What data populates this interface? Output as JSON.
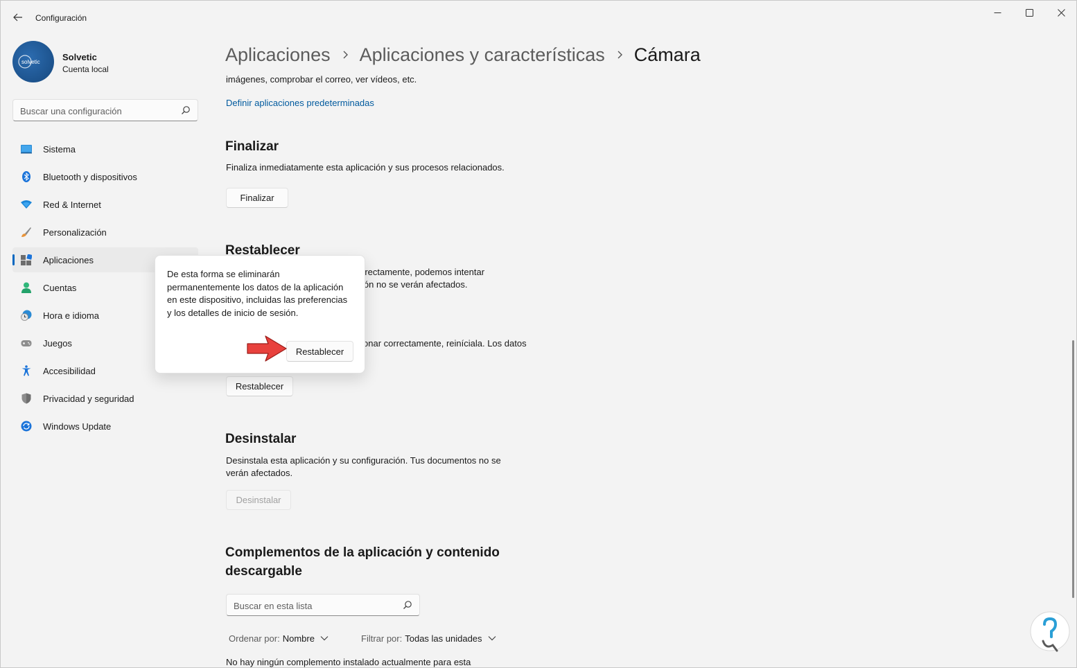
{
  "window": {
    "title": "Configuración",
    "controls": {
      "minimize": "minimize-icon",
      "maximize": "maximize-icon",
      "close": "close-icon"
    }
  },
  "profile": {
    "avatar_text": "solvetic",
    "name": "Solvetic",
    "account": "Cuenta local"
  },
  "search": {
    "placeholder": "Buscar una configuración"
  },
  "sidebar": {
    "items": [
      {
        "label": "Sistema",
        "icon": "system-icon"
      },
      {
        "label": "Bluetooth y dispositivos",
        "icon": "bluetooth-icon"
      },
      {
        "label": "Red & Internet",
        "icon": "wifi-icon"
      },
      {
        "label": "Personalización",
        "icon": "brush-icon"
      },
      {
        "label": "Aplicaciones",
        "icon": "apps-icon",
        "active": true
      },
      {
        "label": "Cuentas",
        "icon": "account-icon"
      },
      {
        "label": "Hora e idioma",
        "icon": "clock-globe-icon"
      },
      {
        "label": "Juegos",
        "icon": "gamepad-icon"
      },
      {
        "label": "Accesibilidad",
        "icon": "accessibility-icon"
      },
      {
        "label": "Privacidad y seguridad",
        "icon": "shield-icon"
      },
      {
        "label": "Windows Update",
        "icon": "update-icon"
      }
    ]
  },
  "breadcrumb": [
    "Aplicaciones",
    "Aplicaciones y características",
    "Cámara"
  ],
  "content": {
    "intro_tail": "imágenes, comprobar el correo, ver vídeos, etc.",
    "default_apps_link": "Definir aplicaciones predeterminadas",
    "finalizar": {
      "title": "Finalizar",
      "description": "Finaliza inmediatamente esta aplicación y sus procesos relacionados.",
      "button": "Finalizar"
    },
    "restablecer": {
      "title": "Restablecer",
      "desc1_line1": "rrectamente, podemos intentar",
      "desc1_line2": "ión no se verán afectados.",
      "desc2_line1": "onar correctamente, reiníciala. Los datos",
      "button": "Restablecer"
    },
    "desinstalar": {
      "title": "Desinstalar",
      "description_line1": "Desinstala esta aplicación y su configuración. Tus documentos no se",
      "description_line2": "verán afectados.",
      "button": "Desinstalar"
    },
    "complementos": {
      "title_line1": "Complementos de la aplicación y contenido",
      "title_line2": "descargable",
      "search_placeholder": "Buscar en esta lista",
      "sort_label": "Ordenar por:",
      "sort_value": "Nombre",
      "filter_label": "Filtrar por:",
      "filter_value": "Todas las unidades",
      "empty_text": "No hay ningún complemento instalado actualmente para esta"
    }
  },
  "flyout": {
    "text": "De esta forma se eliminarán permanentemente los datos de la aplicación en este dispositivo, incluidas las preferencias y los detalles de inicio de sesión.",
    "button": "Restablecer"
  },
  "colors": {
    "accent": "#0067c0",
    "link": "#005a9e",
    "arrow": "#e8413d"
  }
}
